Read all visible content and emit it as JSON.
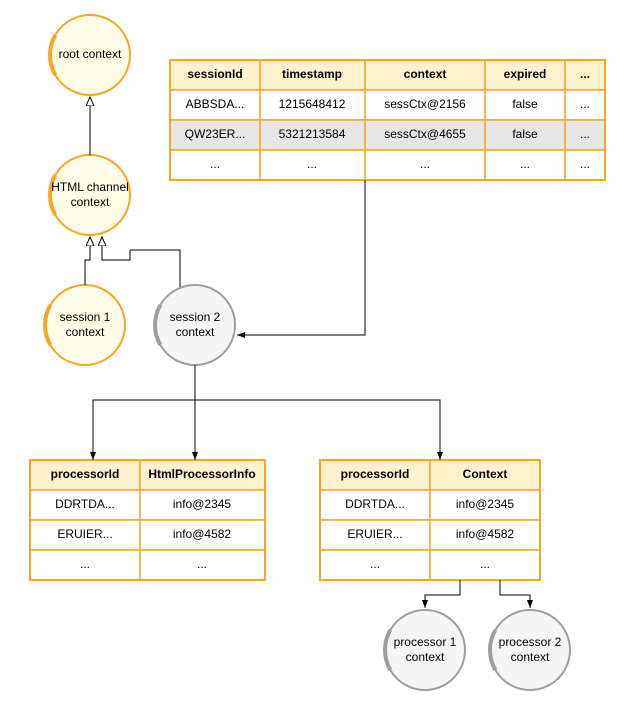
{
  "nodes": {
    "root": "root context",
    "html1": "HTML channel",
    "html2": "context",
    "sess1a": "session 1",
    "sess1b": "context",
    "sess2a": "session 2",
    "sess2b": "context",
    "proc1a": "processor 1",
    "proc1b": "context",
    "proc2a": "processor 2",
    "proc2b": "context"
  },
  "sessTable": {
    "headers": [
      "sessionId",
      "timestamp",
      "context",
      "expired",
      "..."
    ],
    "rows": [
      [
        "ABBSDA...",
        "1215648412",
        "sessCtx@2156",
        "false",
        "..."
      ],
      [
        "QW23ER...",
        "5321213584",
        "sessCtx@4655",
        "false",
        "..."
      ],
      [
        "...",
        "...",
        "...",
        "...",
        "..."
      ]
    ]
  },
  "leftTable": {
    "headers": [
      "processorId",
      "HtmlProcessorInfo"
    ],
    "rows": [
      [
        "DDRTDA...",
        "info@2345"
      ],
      [
        "ERUIER...",
        "info@4582"
      ],
      [
        "...",
        "..."
      ]
    ]
  },
  "rightTable": {
    "headers": [
      "processorId",
      "Context"
    ],
    "rows": [
      [
        "DDRTDA...",
        "info@2345"
      ],
      [
        "ERUIER...",
        "info@4582"
      ],
      [
        "...",
        "..."
      ]
    ]
  }
}
